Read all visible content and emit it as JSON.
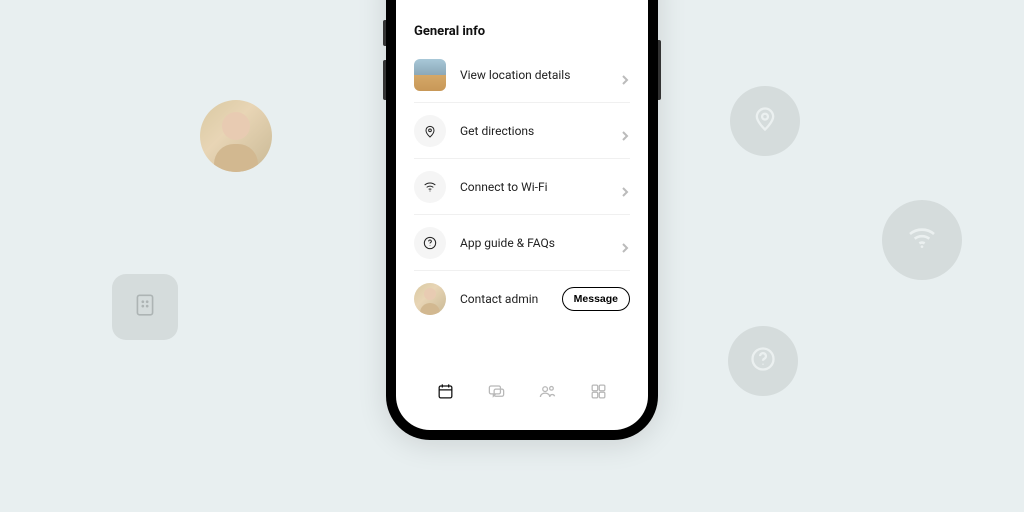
{
  "section_title": "General info",
  "rows": {
    "location": {
      "label": "View location details"
    },
    "directions": {
      "label": "Get directions"
    },
    "wifi": {
      "label": "Connect to Wi-Fi"
    },
    "guide": {
      "label": "App guide & FAQs"
    },
    "admin": {
      "label": "Contact admin",
      "button": "Message"
    }
  },
  "tabs": [
    "calendar",
    "chat",
    "people",
    "apps"
  ]
}
